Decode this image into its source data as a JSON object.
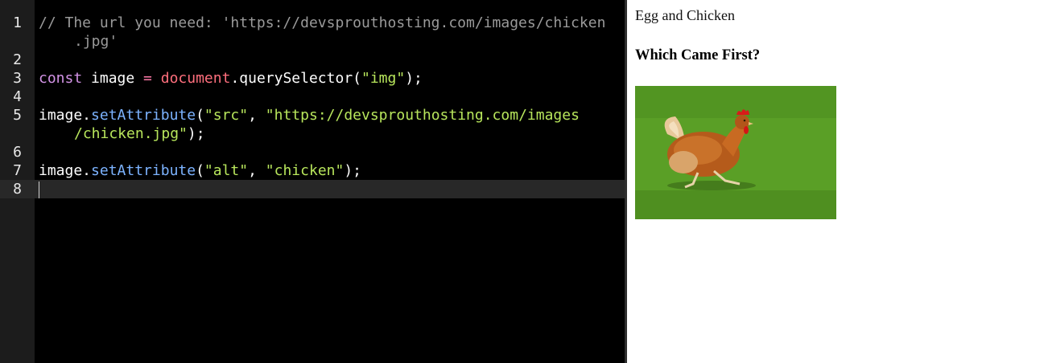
{
  "editor": {
    "lines": [
      {
        "n": "1",
        "segments": [
          {
            "t": "// The url you need: 'https://devsprouthosting.com/images/chicken",
            "c": "comment"
          }
        ],
        "cont": [
          {
            "t": ".jpg'",
            "c": "comment"
          }
        ]
      },
      {
        "n": "2",
        "segments": []
      },
      {
        "n": "3",
        "segments": [
          {
            "t": "const",
            "c": "kw"
          },
          {
            "t": " image ",
            "c": "var"
          },
          {
            "t": "=",
            "c": "op"
          },
          {
            "t": " ",
            "c": "var"
          },
          {
            "t": "document",
            "c": "builtin"
          },
          {
            "t": ".querySelector(",
            "c": "punc"
          },
          {
            "t": "\"img\"",
            "c": "str"
          },
          {
            "t": ");",
            "c": "punc"
          }
        ]
      },
      {
        "n": "4",
        "segments": []
      },
      {
        "n": "5",
        "segments": [
          {
            "t": "image.",
            "c": "var"
          },
          {
            "t": "setAttribute",
            "c": "fn"
          },
          {
            "t": "(",
            "c": "punc"
          },
          {
            "t": "\"src\"",
            "c": "str"
          },
          {
            "t": ", ",
            "c": "punc"
          },
          {
            "t": "\"https://devsprouthosting.com/images",
            "c": "str"
          }
        ],
        "cont": [
          {
            "t": "/chicken.jpg\"",
            "c": "str"
          },
          {
            "t": ");",
            "c": "punc"
          }
        ]
      },
      {
        "n": "6",
        "segments": []
      },
      {
        "n": "7",
        "segments": [
          {
            "t": "image.",
            "c": "var"
          },
          {
            "t": "setAttribute",
            "c": "fn"
          },
          {
            "t": "(",
            "c": "punc"
          },
          {
            "t": "\"alt\"",
            "c": "str"
          },
          {
            "t": ", ",
            "c": "punc"
          },
          {
            "t": "\"chicken\"",
            "c": "str"
          },
          {
            "t": ");",
            "c": "punc"
          }
        ]
      },
      {
        "n": "8",
        "segments": [],
        "active": true
      }
    ],
    "colors": {
      "background": "#000000",
      "gutter": "#1c1c1c",
      "active_line": "#282828"
    }
  },
  "preview": {
    "title_text": "Egg and Chicken",
    "heading": "Which Came First?",
    "image_alt": "chicken"
  }
}
